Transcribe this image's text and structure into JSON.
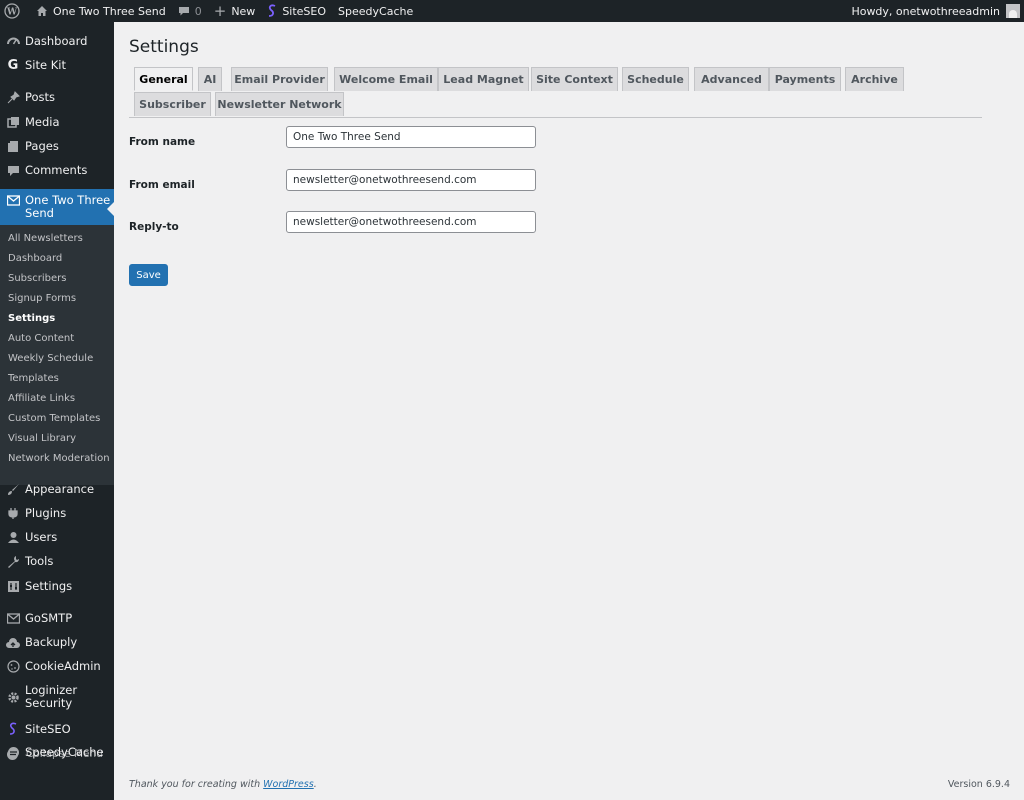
{
  "admin_bar": {
    "site_name": "One Two Three Send",
    "comments_count": "0",
    "new_label": "New",
    "siteseo_label": "SiteSEO",
    "speedycache_label": "SpeedyCache",
    "greeting": "Howdy, onetwothreeadmin"
  },
  "sidebar": {
    "items": [
      {
        "label": "Dashboard",
        "icon": "dashboard-icon"
      },
      {
        "label": "Site Kit",
        "icon": "sitekit-icon"
      },
      {
        "label": "Posts",
        "icon": "pin-icon"
      },
      {
        "label": "Media",
        "icon": "media-icon"
      },
      {
        "label": "Pages",
        "icon": "pages-icon"
      },
      {
        "label": "Comments",
        "icon": "comment-icon"
      },
      {
        "label": "One Two Three\nSend",
        "icon": "mail-icon"
      },
      {
        "label": "Appearance",
        "icon": "brush-icon"
      },
      {
        "label": "Plugins",
        "icon": "plugin-icon"
      },
      {
        "label": "Users",
        "icon": "user-icon"
      },
      {
        "label": "Tools",
        "icon": "wrench-icon"
      },
      {
        "label": "Settings",
        "icon": "settings-icon"
      },
      {
        "label": "GoSMTP",
        "icon": "envelope-icon"
      },
      {
        "label": "Backuply",
        "icon": "cloud-upload-icon"
      },
      {
        "label": "CookieAdmin",
        "icon": "cookie-icon"
      },
      {
        "label": "Loginizer\nSecurity",
        "icon": "gear-icon"
      },
      {
        "label": "SiteSEO",
        "icon": "siteseo-icon"
      },
      {
        "label": "SpeedyCache",
        "icon": "speedycache-icon"
      }
    ],
    "submenu": [
      "All Newsletters",
      "Dashboard",
      "Subscribers",
      "Signup Forms",
      "Settings",
      "Auto Content",
      "Weekly Schedule",
      "Templates",
      "Affiliate Links",
      "Custom Templates",
      "Visual Library",
      "Network Moderation"
    ],
    "collapse_label": "Collapse Menu"
  },
  "main": {
    "title": "Settings",
    "tabs": [
      "General",
      "AI",
      "Email Provider",
      "Welcome Email",
      "Lead Magnet",
      "Site Context",
      "Schedule",
      "Advanced",
      "Payments",
      "Archive",
      "Subscriber",
      "Newsletter Network"
    ],
    "active_tab": "General",
    "form": {
      "from_name_label": "From name",
      "from_name_value": "One Two Three Send",
      "from_email_label": "From email",
      "from_email_value": "newsletter@onetwothreesend.com",
      "reply_to_label": "Reply-to",
      "reply_to_value": "newsletter@onetwothreesend.com",
      "save_label": "Save"
    }
  },
  "footer": {
    "thanks_prefix": "Thank you for creating with ",
    "wordpress_link": "WordPress",
    "thanks_suffix": ".",
    "version": "Version 6.9.4"
  },
  "colors": {
    "admin_bar_bg": "#1d2327",
    "accent": "#2271b1",
    "submenu_bg": "#2c3338",
    "content_bg": "#f0f0f1"
  }
}
